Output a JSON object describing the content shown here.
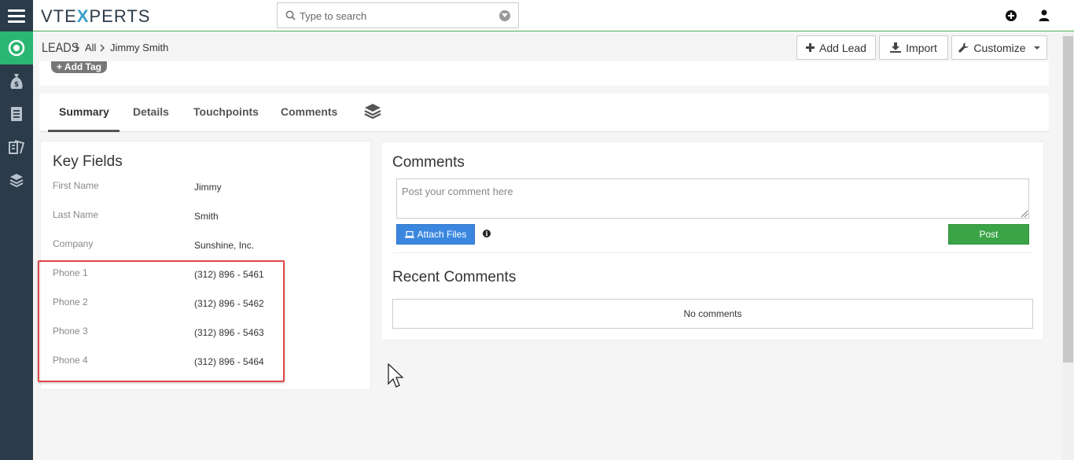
{
  "header": {
    "logo_left": "VTE",
    "logo_x": "X",
    "logo_right": "PERTS",
    "search_placeholder": "Type to search"
  },
  "breadcrumb": {
    "module": "LEADS",
    "list": "All",
    "record": "Jimmy Smith"
  },
  "toolbar": {
    "add_lead": "Add Lead",
    "import": "Import",
    "customize": "Customize"
  },
  "tags": {
    "add_tag": "+ Add Tag"
  },
  "tabs": [
    {
      "label": "Summary"
    },
    {
      "label": "Details"
    },
    {
      "label": "Touchpoints"
    },
    {
      "label": "Comments"
    }
  ],
  "key_fields": {
    "title": "Key Fields",
    "rows": [
      {
        "label": "First Name",
        "value": "Jimmy"
      },
      {
        "label": "Last Name",
        "value": "Smith"
      },
      {
        "label": "Company",
        "value": "Sunshine, Inc."
      },
      {
        "label": "Phone 1",
        "value": "(312) 896 - 5461"
      },
      {
        "label": "Phone 2",
        "value": "(312) 896 - 5462"
      },
      {
        "label": "Phone 3",
        "value": "(312) 896 - 5463"
      },
      {
        "label": "Phone 4",
        "value": "(312) 896 - 5464"
      }
    ]
  },
  "comments": {
    "title": "Comments",
    "placeholder": "Post your comment here",
    "attach_label": "Attach Files",
    "post_label": "Post",
    "recent_title": "Recent Comments",
    "empty_text": "No comments"
  },
  "colors": {
    "sidebar": "#2c3b49",
    "active_green": "#2bb673",
    "attach_blue": "#3b87e0",
    "post_green": "#3aa447",
    "highlight_red": "#e04848"
  }
}
